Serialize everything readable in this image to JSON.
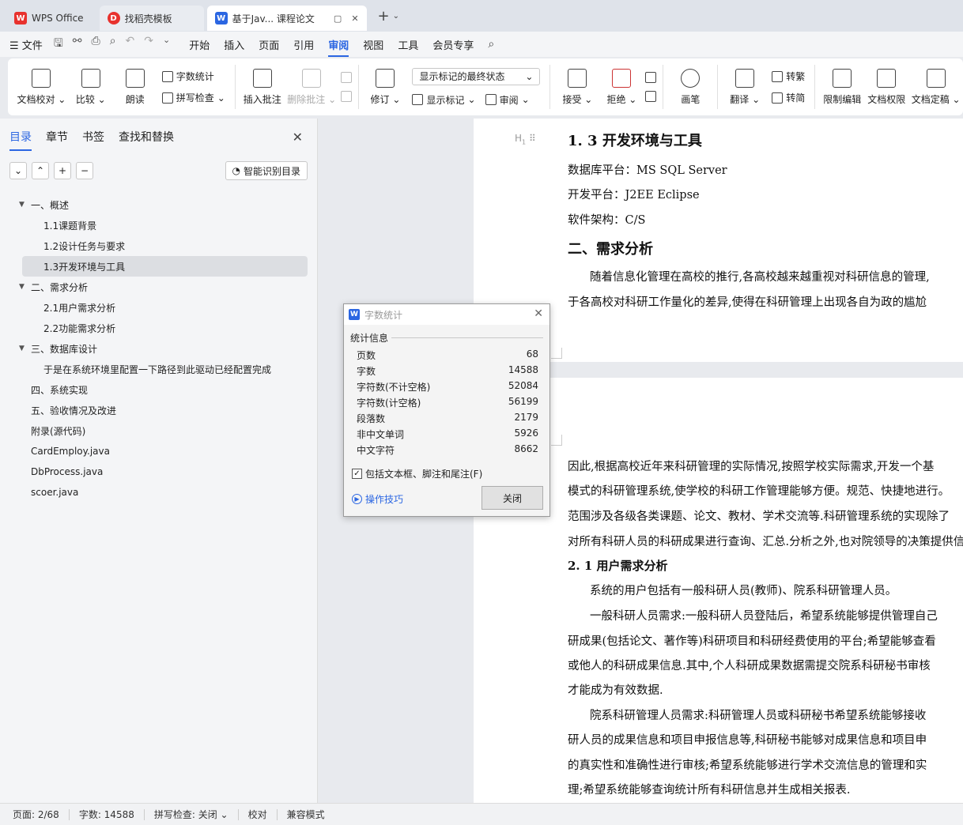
{
  "titlebar": {
    "tabs": [
      {
        "label": "WPS Office"
      },
      {
        "label": "找稻壳模板"
      },
      {
        "label": "基于Jav... 课程论文"
      }
    ]
  },
  "menubar": {
    "file": "文件",
    "items": [
      "开始",
      "插入",
      "页面",
      "引用",
      "审阅",
      "视图",
      "工具",
      "会员专享"
    ],
    "active": "审阅"
  },
  "ribbon": {
    "doc_check": "文档校对",
    "compare": "比较",
    "read_aloud": "朗读",
    "word_count": "字数统计",
    "spell_check": "拼写检查",
    "insert_comment": "插入批注",
    "delete_comment": "删除批注",
    "track": "修订",
    "markup_state": "显示标记的最终状态",
    "show_markup": "显示标记",
    "review": "审阅",
    "accept": "接受",
    "reject": "拒绝",
    "pen": "画笔",
    "translate": "翻译",
    "to_traditional": "转繁",
    "to_simplified": "转简",
    "restrict_edit": "限制编辑",
    "doc_permission": "文档权限",
    "doc_finalize": "文档定稿"
  },
  "nav": {
    "tabs": [
      "目录",
      "章节",
      "书签",
      "查找和替换"
    ],
    "smart_toc": "智能识别目录",
    "toc": [
      {
        "label": "一、概述",
        "level": 1,
        "arrow": true
      },
      {
        "label": "1.1课题背景",
        "level": 2
      },
      {
        "label": "1.2设计任务与要求",
        "level": 2
      },
      {
        "label": "1.3开发环境与工具",
        "level": 2,
        "selected": true
      },
      {
        "label": "二、需求分析",
        "level": 1,
        "arrow": true
      },
      {
        "label": "2.1用户需求分析",
        "level": 2
      },
      {
        "label": "2.2功能需求分析",
        "level": 2
      },
      {
        "label": "三、数据库设计",
        "level": 1,
        "arrow": true
      },
      {
        "label": "于是在系统环境里配置一下路径到此驱动已经配置完成",
        "level": 2
      },
      {
        "label": "四、系统实现",
        "level": 1
      },
      {
        "label": "五、验收情况及改进",
        "level": 1
      },
      {
        "label": "附录(源代码)",
        "level": 1
      },
      {
        "label": "CardEmploy.java",
        "level": 1
      },
      {
        "label": "DbProcess.java",
        "level": 1
      },
      {
        "label": "scoer.java",
        "level": 1
      }
    ]
  },
  "document": {
    "heading_marker": "H",
    "page1": {
      "h_13": "1. 3 开发环境与工具",
      "db": "数据库平台：MS SQL Server",
      "dev": "开发平台：J2EE Eclipse",
      "arch": "软件架构：C/S",
      "h_2": "二、需求分析",
      "para1_l1": "随着信息化管理在高校的推行,各高校越来越重视对科研信息的管理,",
      "para1_l2": "于各高校对科研工作量化的差异,使得在科研管理上出现各自为政的尴尬"
    },
    "page2": {
      "l1": "因此,根据高校近年来科研管理的实际情况,按照学校实际需求,开发一个基",
      "l2": "模式的科研管理系统,使学校的科研工作管理能够方便。规范、快捷地进行。",
      "l3": "范围涉及各级各类课题、论文、教材、学术交流等.科研管理系统的实现除了",
      "l4": "对所有科研人员的科研成果进行查询、汇总.分析之外,也对院领导的决策提供信",
      "h_21": "2. 1 用户需求分析",
      "l5": "系统的用户包括有一般科研人员(教师)、院系科研管理人员。",
      "l6": "一般科研人员需求:一般科研人员登陆后，希望系统能够提供管理自己",
      "l7": "研成果(包括论文、著作等)科研项目和科研经费使用的平台;希望能够查看",
      "l8": "或他人的科研成果信息.其中,个人科研成果数据需提交院系科研秘书审核",
      "l9": "才能成为有效数据.",
      "l10": "院系科研管理人员需求:科研管理人员或科研秘书希望系统能够接收",
      "l11": "研人员的成果信息和项目申报信息等,科研秘书能够对成果信息和项目申",
      "l12": "的真实性和准确性进行审核;希望系统能够进行学术交流信息的管理和实",
      "l13": "理;希望系统能够查询统计所有科研信息并生成相关报表."
    }
  },
  "dialog": {
    "title": "字数统计",
    "group": "统计信息",
    "stats": [
      {
        "label": "页数",
        "value": "68"
      },
      {
        "label": "字数",
        "value": "14588"
      },
      {
        "label": "字符数(不计空格)",
        "value": "52084"
      },
      {
        "label": "字符数(计空格)",
        "value": "56199"
      },
      {
        "label": "段落数",
        "value": "2179"
      },
      {
        "label": "非中文单词",
        "value": "5926"
      },
      {
        "label": "中文字符",
        "value": "8662"
      }
    ],
    "checkbox_label": "包括文本框、脚注和尾注(F)",
    "tips": "操作技巧",
    "close": "关闭"
  },
  "statusbar": {
    "page": "页面: 2/68",
    "words": "字数: 14588",
    "spell": "拼写检查: 关闭",
    "proof": "校对",
    "compat": "兼容模式"
  }
}
